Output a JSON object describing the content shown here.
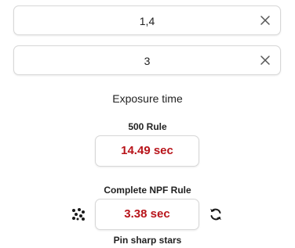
{
  "inputs": {
    "aperture": {
      "value": "1,4"
    },
    "focal": {
      "value": "3"
    }
  },
  "exposure": {
    "heading": "Exposure time",
    "rule500": {
      "title": "500 Rule",
      "value": "14.49 sec"
    },
    "npf": {
      "title": "Complete NPF Rule",
      "value": "3.38 sec",
      "caption": "Pin sharp stars"
    }
  },
  "icons": {
    "clear": "close-icon",
    "stars": "stars-dots-icon",
    "refresh": "refresh-icon"
  },
  "colors": {
    "result": "#b8141a",
    "border": "#d7d7d7",
    "text": "#222222"
  }
}
